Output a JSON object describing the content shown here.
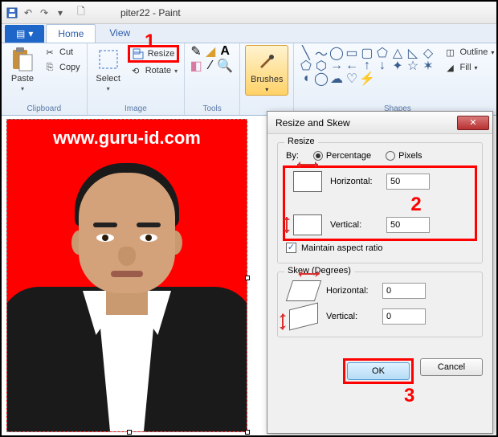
{
  "window": {
    "title": "piter22 - Paint"
  },
  "tabs": {
    "file": "",
    "home": "Home",
    "view": "View"
  },
  "ribbon": {
    "clipboard": {
      "label": "Clipboard",
      "paste": "Paste",
      "cut": "Cut",
      "copy": "Copy"
    },
    "image": {
      "label": "Image",
      "select": "Select",
      "resize": "Resize",
      "rotate": "Rotate"
    },
    "tools": {
      "label": "Tools"
    },
    "brushes": {
      "label": "Brushes"
    },
    "shapes": {
      "label": "Shapes",
      "outline": "Outline",
      "fill": "Fill"
    }
  },
  "canvas": {
    "watermark": "www.guru-id.com"
  },
  "dialog": {
    "title": "Resize and Skew",
    "resize": {
      "legend": "Resize",
      "by": "By:",
      "percentage": "Percentage",
      "pixels": "Pixels",
      "horizontal": "Horizontal:",
      "vertical": "Vertical:",
      "h_val": "50",
      "v_val": "50",
      "maintain": "Maintain aspect ratio"
    },
    "skew": {
      "legend": "Skew (Degrees)",
      "horizontal": "Horizontal:",
      "vertical": "Vertical:",
      "h_val": "0",
      "v_val": "0"
    },
    "ok": "OK",
    "cancel": "Cancel"
  },
  "annotations": {
    "a1": "1",
    "a2": "2",
    "a3": "3"
  }
}
